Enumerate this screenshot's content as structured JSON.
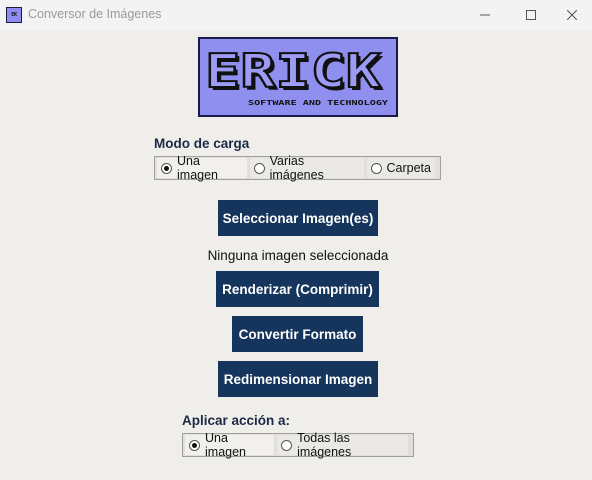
{
  "window": {
    "title": "Conversor de Imágenes",
    "app_icon": "erick-logo-icon",
    "controls": [
      "minimize-icon",
      "maximize-icon",
      "close-icon"
    ]
  },
  "logo": {
    "main_text": "ERICK",
    "sub_text": "SOFTWARE AND TECHNOLOGY",
    "colors": {
      "background": "#8f8ff0",
      "outline": "#111111"
    }
  },
  "load_mode": {
    "label": "Modo de carga",
    "options": [
      "Una imagen",
      "Varias imágenes",
      "Carpeta"
    ],
    "selected": "Una imagen"
  },
  "buttons": {
    "select_images": "Seleccionar Imagen(es)",
    "render": "Renderizar (Comprimir)",
    "convert": "Convertir Formato",
    "resize": "Redimensionar Imagen"
  },
  "status": "Ninguna imagen seleccionada",
  "apply_to": {
    "label": "Aplicar acción a:",
    "options": [
      "Una imagen",
      "Todas las imágenes"
    ],
    "selected": "Una imagen"
  },
  "colors": {
    "button_bg": "#16355c",
    "label_text": "#1b2a45",
    "window_bg": "#f0eeeb"
  }
}
